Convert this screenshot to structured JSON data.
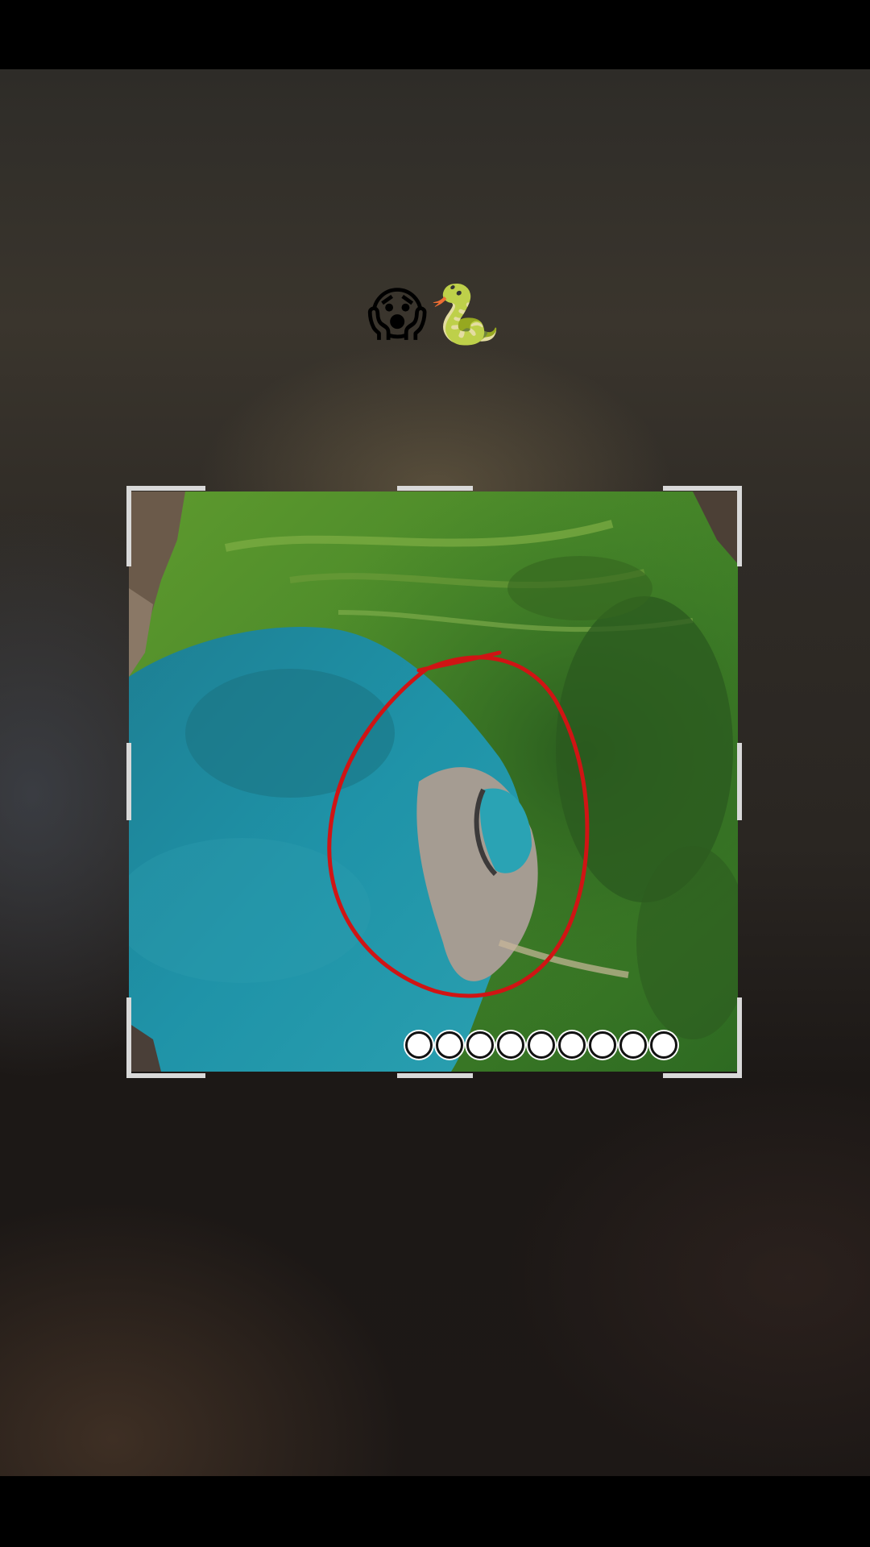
{
  "caption": {
    "text": "😱🐍"
  },
  "photo": {
    "icon": "aerial-lagoon-photo",
    "annotation_color": "#d01414"
  },
  "progress": {
    "total_dots": 9
  },
  "colors": {
    "water": "#1f8fa3",
    "vegetation": "#4f8f2a",
    "sand": "#a59c92",
    "handles": "#d9d9d9",
    "bars": "#000000"
  }
}
